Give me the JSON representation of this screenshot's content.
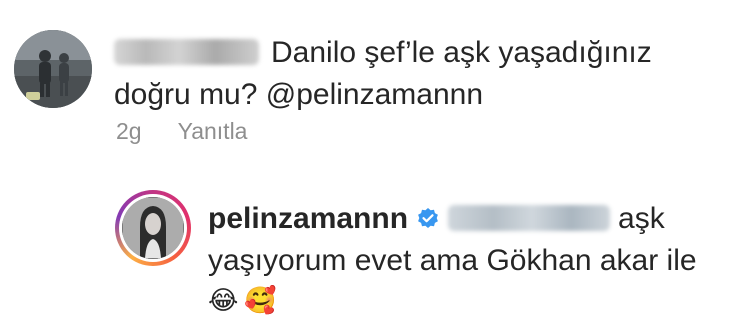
{
  "comment": {
    "avatar_icon": "user-avatar-photo",
    "username_blurred": true,
    "text": "Danilo şef’le aşk yaşadığınız doğru mu?",
    "mention": "@pelinzamannn",
    "time": "2g",
    "reply_label": "Yanıtla"
  },
  "reply": {
    "avatar_icon": "pelinzamannn-avatar-photo",
    "username": "pelinzamannn",
    "verified_icon": "verified-badge-icon",
    "verified_color": "#3897f0",
    "mention_blurred": true,
    "text": "aşk yaşıyorum evet ama Gökhan akar ile",
    "emojis": [
      "😂",
      "🥰"
    ]
  },
  "colors": {
    "text": "#262626",
    "meta": "#8e8e8e",
    "story_ring_start": "#c13584",
    "story_ring_end": "#fcaf45"
  }
}
